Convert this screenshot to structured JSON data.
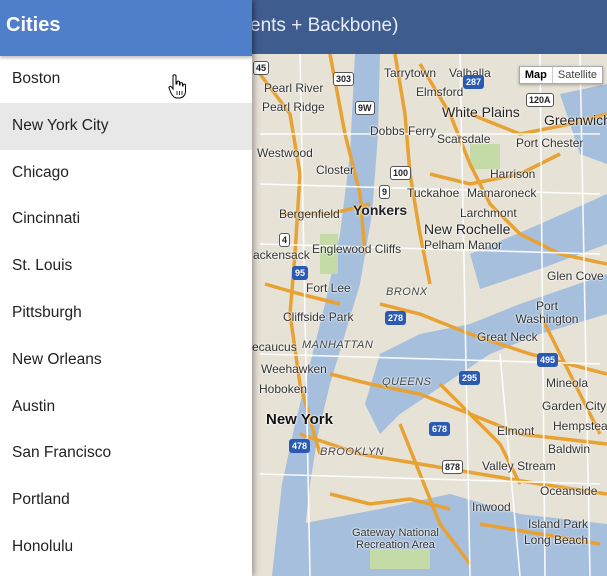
{
  "app": {
    "title_partial": "ents + Backbone)"
  },
  "drawer": {
    "title": "Cities",
    "selected_index": 1,
    "cities": [
      "Boston",
      "New York City",
      "Chicago",
      "Cincinnati",
      "St. Louis",
      "Pittsburgh",
      "New Orleans",
      "Austin",
      "San Francisco",
      "Portland",
      "Honolulu"
    ]
  },
  "map": {
    "type_buttons": [
      "Map",
      "Satellite"
    ],
    "active_type": "Map",
    "labels": {
      "tarrytown": "Tarrytown",
      "valhalla": "Valhalla",
      "pearl_river": "Pearl River",
      "elmsford": "Elmsford",
      "pearl_ridge": "Pearl Ridge",
      "white_plains": "White Plains",
      "greenwich": "Greenwich",
      "dobbs_ferry": "Dobbs Ferry",
      "scarsdale": "Scarsdale",
      "port_chester": "Port Chester",
      "westwood": "Westwood",
      "closter": "Closter",
      "harrison": "Harrison",
      "tuckahoe": "Tuckahoe",
      "mamaroneck": "Mamaroneck",
      "yonkers": "Yonkers",
      "bergenfield": "Bergenfield",
      "larchmont": "Larchmont",
      "new_rochelle": "New Rochelle",
      "pelham_manor": "Pelham Manor",
      "englewood_cliffs": "Englewood Cliffs",
      "hackensack": "ackensack",
      "glen_cove": "Glen Cove",
      "fort_lee": "Fort Lee",
      "bronx": "BRONX",
      "port_washington": "Port Washington",
      "cliffside_park": "Cliffside Park",
      "great_neck": "Great Neck",
      "secaucus": "ecaucus",
      "manhattan": "MANHATTAN",
      "weehawken": "Weehawken",
      "mineola": "Mineola",
      "hoboken": "Hoboken",
      "queens": "QUEENS",
      "garden_city": "Garden City",
      "new_york": "New York",
      "hempstead": "Hempstea",
      "brooklyn": "BROOKLYN",
      "elmont": "Elmont",
      "baldwin": "Baldwin",
      "valley_stream": "Valley Stream",
      "oceanside": "Oceanside",
      "inwood": "Inwood",
      "island_park": "Island Park",
      "gateway": "Gateway National",
      "recreation_area": "Recreation Area",
      "long_beach": "Long Beach"
    },
    "shields": {
      "s45": "45",
      "s303": "303",
      "s287": "287",
      "s9w": "9W",
      "s120a": "120A",
      "s100": "100",
      "s9": "9",
      "s4": "4",
      "s95": "95",
      "s278": "278",
      "s495": "495",
      "s295": "295",
      "s478": "478",
      "s678": "678",
      "s878": "878"
    }
  }
}
